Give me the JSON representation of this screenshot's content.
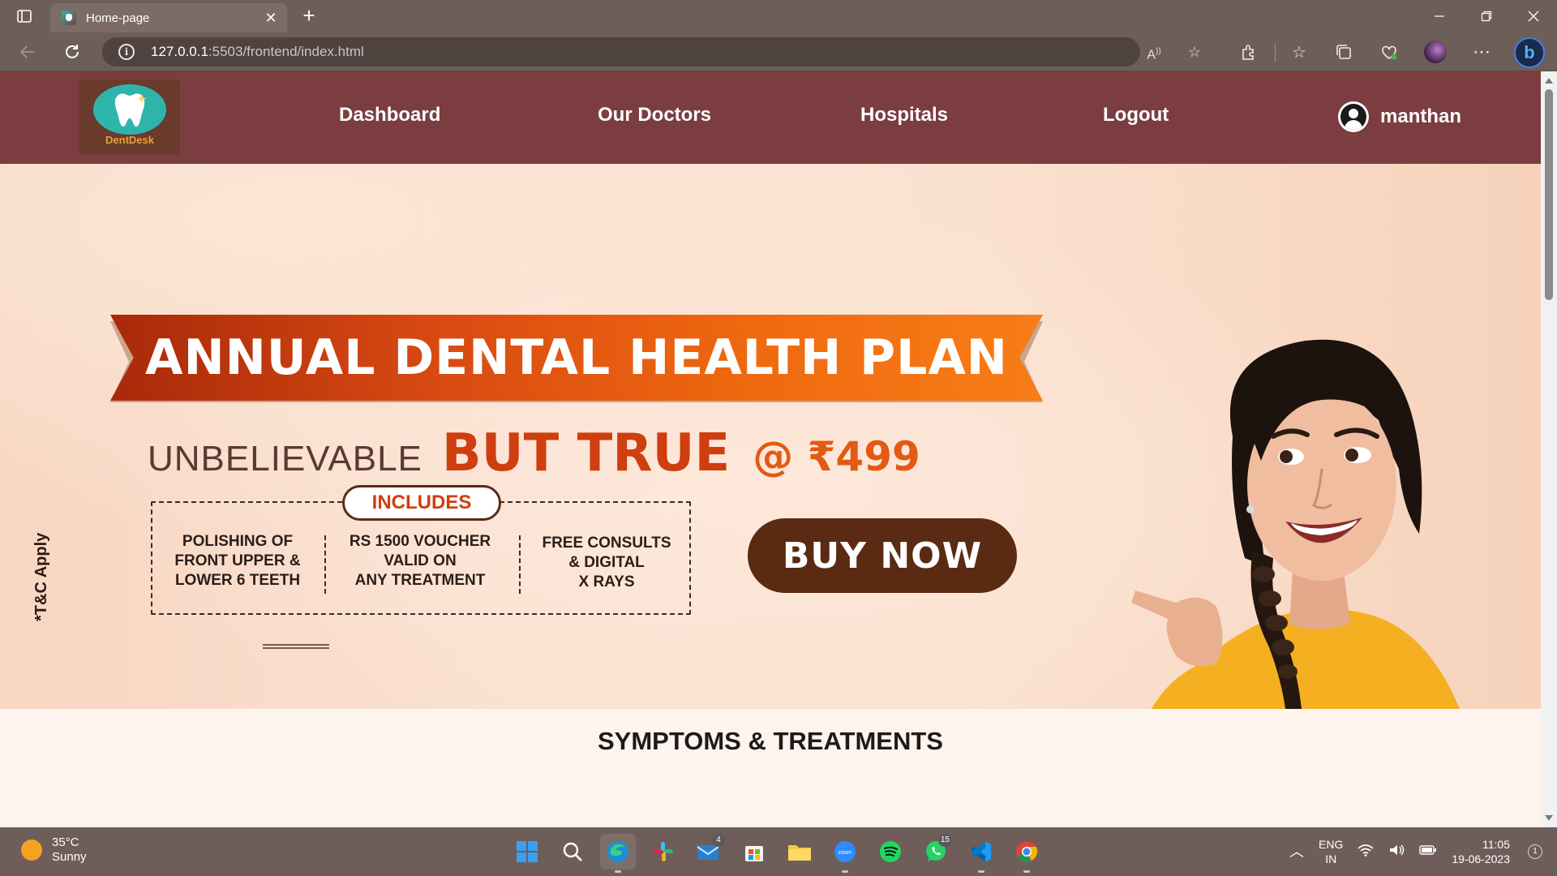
{
  "browser": {
    "tab_title": "Home-page",
    "url_host": "127.0.0.1",
    "url_rest": ":5503/frontend/index.html"
  },
  "site": {
    "logo_text": "DentDesk",
    "nav": {
      "dashboard": "Dashboard",
      "our_doctors": "Our Doctors",
      "hospitals": "Hospitals",
      "logout": "Logout"
    },
    "user_name": "manthan"
  },
  "banner": {
    "ribbon_title": "ANNUAL DENTAL HEALTH PLAN",
    "tag_light": "UNBELIEVABLE",
    "tag_bold": "BUT TRUE",
    "tag_price": "@ ₹499",
    "includes_label": "INCLUDES",
    "includes": [
      {
        "line1": "POLISHING OF",
        "line2": "FRONT UPPER &",
        "line3": "LOWER 6 TEETH"
      },
      {
        "line1": "RS 1500 VOUCHER",
        "line2": "VALID ON",
        "line3": "ANY TREATMENT"
      },
      {
        "line1": "FREE CONSULTS",
        "line2": "& DIGITAL",
        "line3": "X RAYS"
      }
    ],
    "buy_now": "BUY NOW",
    "tnc": "*T&C Apply"
  },
  "section_title": "SYMPTOMS & TREATMENTS",
  "taskbar": {
    "weather_temp": "35°C",
    "weather_desc": "Sunny",
    "mail_badge": "4",
    "whatsapp_badge": "15",
    "lang_top": "ENG",
    "lang_bottom": "IN",
    "time": "11:05",
    "date": "19-06-2023",
    "notifications": "1"
  },
  "colors": {
    "site_nav_bg": "#7b3d40",
    "ribbon_orange": "#f06a10",
    "accent_red": "#cf3e0e",
    "buy_button": "#5a2a12"
  }
}
